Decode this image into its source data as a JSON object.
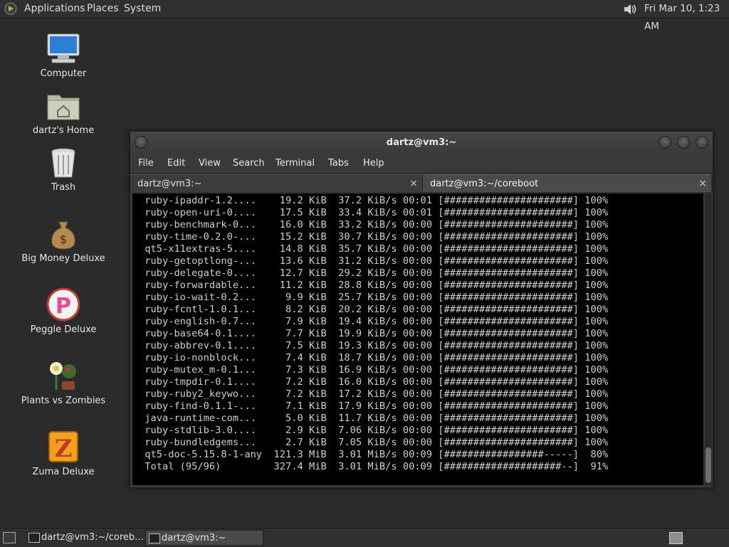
{
  "topbar": {
    "applications": "Applications",
    "places": "Places",
    "system": "System",
    "clock": "Fri Mar 10,  1:23 AM"
  },
  "desktop_icons": [
    {
      "label": "Computer"
    },
    {
      "label": "dartz's Home"
    },
    {
      "label": "Trash"
    },
    {
      "label": "Big Money Deluxe"
    },
    {
      "label": "Peggle Deluxe"
    },
    {
      "label": "Plants vs Zombies"
    },
    {
      "label": "Zuma Deluxe"
    }
  ],
  "window": {
    "title": "dartz@vm3:~",
    "menu": [
      "File",
      "Edit",
      "View",
      "Search",
      "Terminal",
      "Tabs",
      "Help"
    ],
    "tabs": [
      {
        "label": "dartz@vm3:~",
        "close": "×"
      },
      {
        "label": "dartz@vm3:~/coreboot",
        "close": "×"
      }
    ]
  },
  "terminal": {
    "lines": [
      " ruby-ipaddr-1.2....    19.2 KiB  37.2 KiB/s 00:01 [######################] 100%",
      " ruby-open-uri-0....    17.5 KiB  33.4 KiB/s 00:01 [######################] 100%",
      " ruby-benchmark-0...    16.0 KiB  33.2 KiB/s 00:00 [######################] 100%",
      " ruby-time-0.2.0-...    15.2 KiB  30.7 KiB/s 00:00 [######################] 100%",
      " qt5-x11extras-5....    14.8 KiB  35.7 KiB/s 00:00 [######################] 100%",
      " ruby-getoptlong-...    13.6 KiB  31.2 KiB/s 00:00 [######################] 100%",
      " ruby-delegate-0....    12.7 KiB  29.2 KiB/s 00:00 [######################] 100%",
      " ruby-forwardable...    11.2 KiB  28.8 KiB/s 00:00 [######################] 100%",
      " ruby-io-wait-0.2...     9.9 KiB  25.7 KiB/s 00:00 [######################] 100%",
      " ruby-fcntl-1.0.1...     8.2 KiB  20.2 KiB/s 00:00 [######################] 100%",
      " ruby-english-0.7...     7.9 KiB  19.4 KiB/s 00:00 [######################] 100%",
      " ruby-base64-0.1....     7.7 KiB  19.9 KiB/s 00:00 [######################] 100%",
      " ruby-abbrev-0.1....     7.5 KiB  19.3 KiB/s 00:00 [######################] 100%",
      " ruby-io-nonblock...     7.4 KiB  18.7 KiB/s 00:00 [######################] 100%",
      " ruby-mutex_m-0.1...     7.3 KiB  16.9 KiB/s 00:00 [######################] 100%",
      " ruby-tmpdir-0.1....     7.2 KiB  16.0 KiB/s 00:00 [######################] 100%",
      " ruby-ruby2_keywo...     7.2 KiB  17.2 KiB/s 00:00 [######################] 100%",
      " ruby-find-0.1.1-...     7.1 KiB  17.9 KiB/s 00:00 [######################] 100%",
      " java-runtime-com...     5.0 KiB  11.7 KiB/s 00:00 [######################] 100%",
      " ruby-stdlib-3.0....     2.9 KiB  7.06 KiB/s 00:00 [######################] 100%",
      " ruby-bundledgems...     2.7 KiB  7.05 KiB/s 00:00 [######################] 100%",
      " qt5-doc-5.15.8-1-any  121.3 MiB  3.01 MiB/s 00:09 [#################-----]  80%",
      " Total (95/96)         327.4 MiB  3.01 MiB/s 00:09 [####################--]  91%"
    ]
  },
  "taskbar": {
    "items": [
      {
        "label": "dartz@vm3:~/coreb..."
      },
      {
        "label": "dartz@vm3:~"
      }
    ]
  }
}
